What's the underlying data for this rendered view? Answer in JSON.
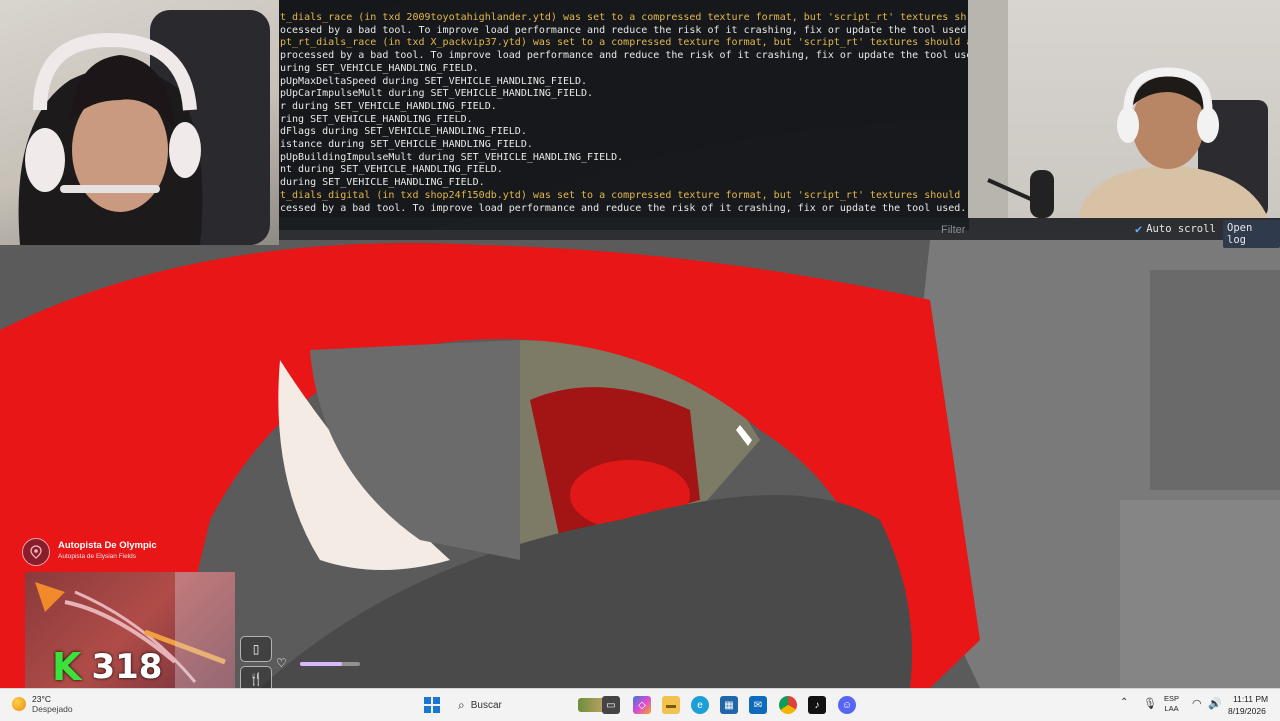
{
  "console": {
    "lines": [
      {
        "text": "t_dials_race (in txd 2009toyotahighlander.ytd) was set to a compressed texture format, but 'script_rt' textures sh",
        "warn": true
      },
      {
        "text": "ocessed by a bad tool. To improve load performance and reduce the risk of it crashing, fix or update the tool used.",
        "warn": false
      },
      {
        "text": "pt_rt_dials_race (in txd X_packvip37.ytd) was set to a compressed texture format, but 'script_rt' textures should a",
        "warn": true
      },
      {
        "text": "processed by a bad tool. To improve load performance and reduce the risk of it crashing, fix or update the tool use",
        "warn": false
      },
      {
        "text": "uring SET_VEHICLE_HANDLING_FIELD.",
        "warn": false
      },
      {
        "text": "pUpMaxDeltaSpeed during SET_VEHICLE_HANDLING_FIELD.",
        "warn": false
      },
      {
        "text": "pUpCarImpulseMult during SET_VEHICLE_HANDLING_FIELD.",
        "warn": false
      },
      {
        "text": "r during SET_VEHICLE_HANDLING_FIELD.",
        "warn": false
      },
      {
        "text": "ring SET_VEHICLE_HANDLING_FIELD.",
        "warn": false
      },
      {
        "text": "dFlags during SET_VEHICLE_HANDLING_FIELD.",
        "warn": false
      },
      {
        "text": "istance during SET_VEHICLE_HANDLING_FIELD.",
        "warn": false
      },
      {
        "text": "pUpBuildingImpulseMult during SET_VEHICLE_HANDLING_FIELD.",
        "warn": false
      },
      {
        "text": "nt during SET_VEHICLE_HANDLING_FIELD.",
        "warn": false
      },
      {
        "text": "during SET_VEHICLE_HANDLING_FIELD.",
        "warn": false
      },
      {
        "text": "t_dials_digital (in txd shop24f150db.ytd) was set to a compressed texture format, but 'script_rt' textures should",
        "warn": true
      },
      {
        "text": "cessed by a bad tool. To improve load performance and reduce the risk of it crashing, fix or update the tool used.",
        "warn": false
      }
    ],
    "filter_placeholder": "Filter",
    "autoscroll_label": "Auto scroll",
    "open_log_label": "Open log",
    "warn_color": "#e2b84a"
  },
  "hud": {
    "location_title": "Autopista De Olympic",
    "location_subtitle": "Autopista de Elysian Fields",
    "money_icon_glyph": "K",
    "money_value": "318"
  },
  "taskbar": {
    "weather_temp": "23°C",
    "weather_desc": "Despejado",
    "search_label": "Buscar",
    "lang_top": "ESP",
    "lang_bottom": "LAA",
    "time": "11:11 PM",
    "date": "8/19/2026",
    "apps": [
      "file-explorer-icon",
      "store-icon",
      "copilot-icon",
      "folder-icon",
      "edge-icon",
      "calendar-icon",
      "outlook-icon",
      "chrome-icon",
      "tiktok-icon",
      "discord-icon"
    ]
  }
}
